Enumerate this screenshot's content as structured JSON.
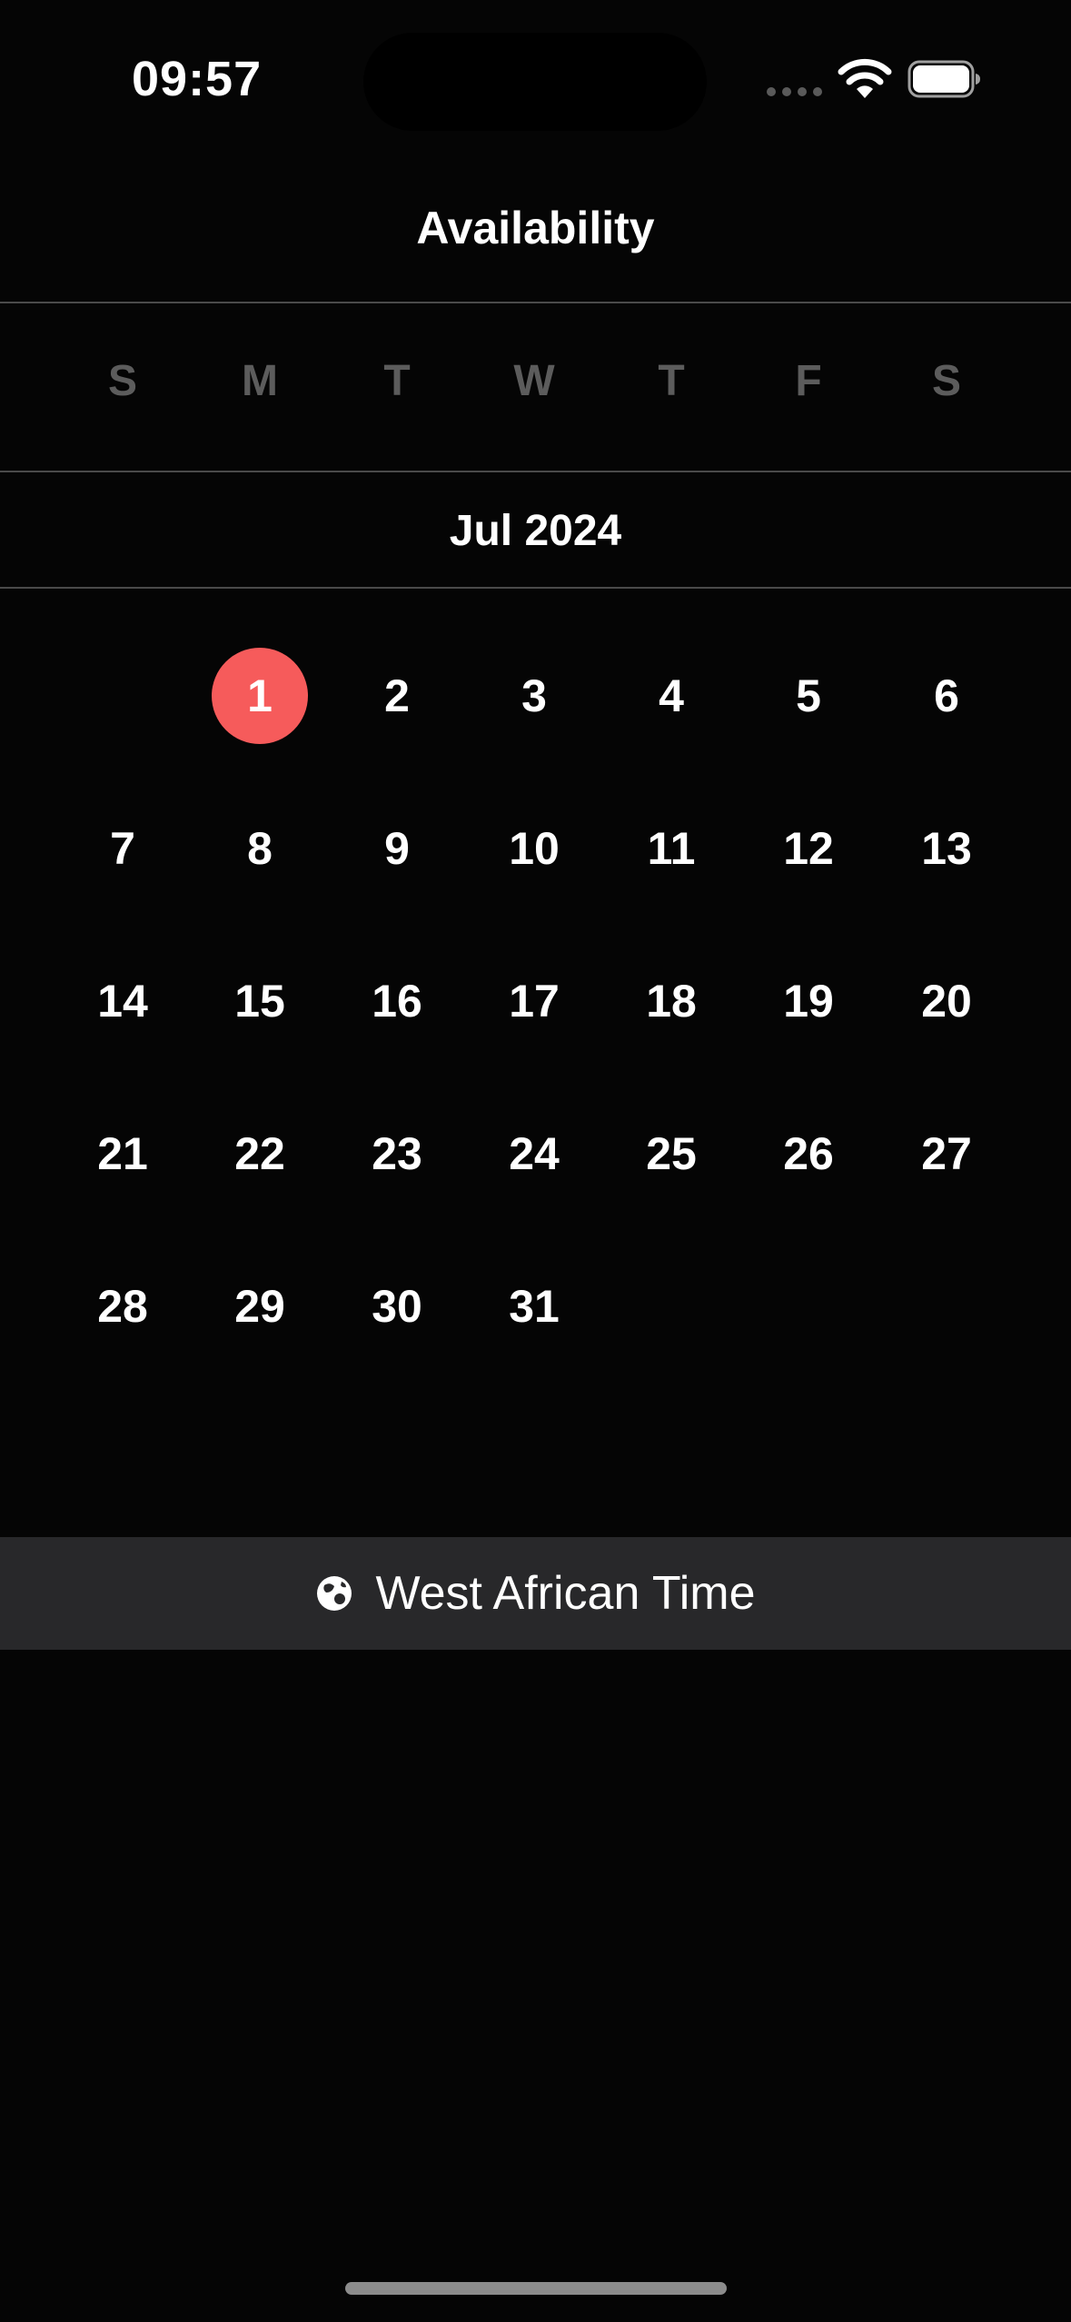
{
  "status_bar": {
    "time": "09:57",
    "icons": [
      "cellular-dots-icon",
      "wifi-icon",
      "battery-icon"
    ]
  },
  "header": {
    "title": "Availability"
  },
  "calendar": {
    "weekdays": [
      "S",
      "M",
      "T",
      "W",
      "T",
      "F",
      "S"
    ],
    "month_label": "Jul 2024",
    "selected_day": "1",
    "accent_color": "#f65b5b",
    "weeks": [
      [
        "",
        "1",
        "2",
        "3",
        "4",
        "5",
        "6"
      ],
      [
        "7",
        "8",
        "9",
        "10",
        "11",
        "12",
        "13"
      ],
      [
        "14",
        "15",
        "16",
        "17",
        "18",
        "19",
        "20"
      ],
      [
        "21",
        "22",
        "23",
        "24",
        "25",
        "26",
        "27"
      ],
      [
        "28",
        "29",
        "30",
        "31",
        "",
        "",
        ""
      ]
    ]
  },
  "timezone": {
    "icon": "globe-icon",
    "label": "West African Time"
  }
}
